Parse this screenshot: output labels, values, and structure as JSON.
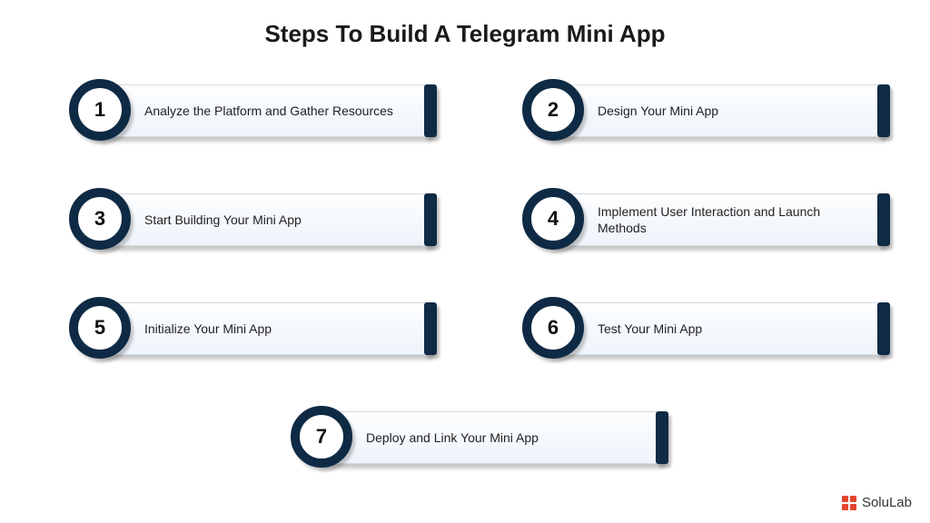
{
  "title": "Steps To Build A Telegram Mini App",
  "steps": [
    {
      "num": "1",
      "label": "Analyze the Platform and Gather Resources"
    },
    {
      "num": "2",
      "label": "Design Your Mini App"
    },
    {
      "num": "3",
      "label": "Start Building Your Mini App"
    },
    {
      "num": "4",
      "label": "Implement User Interaction and Launch Methods"
    },
    {
      "num": "5",
      "label": "Initialize Your Mini App"
    },
    {
      "num": "6",
      "label": "Test Your Mini App"
    },
    {
      "num": "7",
      "label": "Deploy and Link Your Mini App"
    }
  ],
  "brand": "SoluLab",
  "colors": {
    "accent_dark": "#0f2a44",
    "brand_red": "#e3452f"
  }
}
